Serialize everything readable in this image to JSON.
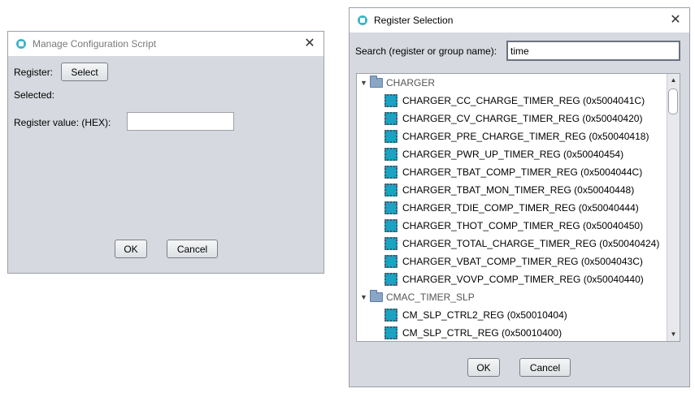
{
  "left_dialog": {
    "title": "Manage Configuration Script",
    "register_label": "Register:",
    "select_button": "Select",
    "selected_label": "Selected:",
    "value_label": "Register value: (HEX):",
    "value_input": "",
    "ok_button": "OK",
    "cancel_button": "Cancel"
  },
  "right_dialog": {
    "title": "Register Selection",
    "search_label": "Search (register or group name):",
    "search_value": "time",
    "ok_button": "OK",
    "cancel_button": "Cancel",
    "tree": {
      "groups": [
        {
          "name": "CHARGER",
          "items": [
            "CHARGER_CC_CHARGE_TIMER_REG (0x5004041C)",
            "CHARGER_CV_CHARGE_TIMER_REG (0x50040420)",
            "CHARGER_PRE_CHARGE_TIMER_REG (0x50040418)",
            "CHARGER_PWR_UP_TIMER_REG (0x50040454)",
            "CHARGER_TBAT_COMP_TIMER_REG (0x5004044C)",
            "CHARGER_TBAT_MON_TIMER_REG (0x50040448)",
            "CHARGER_TDIE_COMP_TIMER_REG (0x50040444)",
            "CHARGER_THOT_COMP_TIMER_REG (0x50040450)",
            "CHARGER_TOTAL_CHARGE_TIMER_REG (0x50040424)",
            "CHARGER_VBAT_COMP_TIMER_REG (0x5004043C)",
            "CHARGER_VOVP_COMP_TIMER_REG (0x50040440)"
          ]
        },
        {
          "name": "CMAC_TIMER_SLP",
          "items": [
            "CM_SLP_CTRL2_REG (0x50010404)",
            "CM_SLP_CTRL_REG (0x50010400)"
          ]
        }
      ]
    }
  },
  "icons": {
    "app": "app-icon",
    "close": "close-icon",
    "folder": "folder-icon",
    "register": "chip-icon",
    "expanded": "triangle-down-icon"
  }
}
